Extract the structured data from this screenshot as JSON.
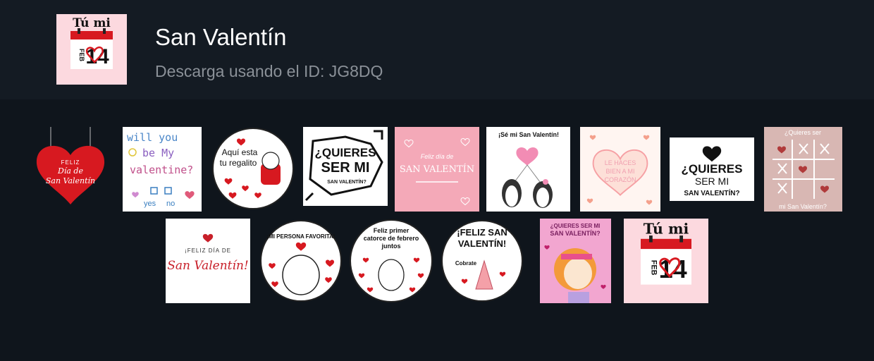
{
  "pack": {
    "title": "San Valentín",
    "subtitle": "Descarga usando el ID: JG8DQ",
    "thumb_icon": "calendar-feb-14-icon"
  },
  "calendar": {
    "top_text": "Tú mi",
    "month": "FEB",
    "day": "14"
  },
  "stickers": {
    "s1": {
      "line1": "FELIZ",
      "line2": "Día de",
      "line3": "San Valentín"
    },
    "s2": {
      "line1": "will you",
      "line2": "be My",
      "line3": "valentine?",
      "yes": "yes",
      "no": "no"
    },
    "s3": {
      "line1": "Aquí esta",
      "line2": "tu regalito"
    },
    "s4": {
      "line1": "¿QUIERES",
      "line2": "SER MI",
      "line3": "SAN VALENTÍN?"
    },
    "s5": {
      "line1": "Feliz día de",
      "line2": "SAN VALENTÍN"
    },
    "s6": {
      "line1": "¡Sé mi San Valentín!"
    },
    "s7": {
      "line1": "LE HACES",
      "line2": "BIEN A MI",
      "line3": "CORAZÓN"
    },
    "s8": {
      "line1": "¿QUIERES",
      "line2": "SER MI",
      "line3": "SAN VALENTÍN?"
    },
    "s9": {
      "line1": "¿Quieres ser",
      "line2": "mi San Valentín?"
    },
    "s10": {
      "line1": "¡FELIZ DÍA DE",
      "line2": "San Valentín!"
    },
    "s11": {
      "line1": "¡MI PERSONA FAVORITA!"
    },
    "s12": {
      "line1": "Feliz primer",
      "line2": "catorce de febrero",
      "line3": "juntos"
    },
    "s13": {
      "line1": "¡FELIZ SAN",
      "line2": "VALENTÍN!",
      "line3": "Cobrate"
    },
    "s14": {
      "line1": "¿QUIERES SER MI",
      "line2": "SAN VALENTÍN?"
    }
  },
  "colors": {
    "header_bg": "#141b23",
    "page_bg": "#0f151c",
    "accent_red": "#d71920",
    "pink": "#f6b8c4"
  }
}
